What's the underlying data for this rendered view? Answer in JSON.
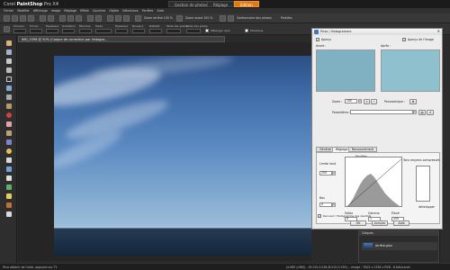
{
  "app": {
    "title_prefix": "Corel ",
    "title_brand": "PaintShop",
    "title_suffix": " Pro X4",
    "workspace_tabs": [
      {
        "label": "Gestion de photos",
        "active": false
      },
      {
        "label": "Réglage",
        "active": false
      },
      {
        "label": "Edition",
        "active": true
      }
    ]
  },
  "menu": [
    "Fichier",
    "Modifier",
    "Affichage",
    "Image",
    "Réglage",
    "Effets",
    "Couches",
    "Objets",
    "Sélections",
    "Fenêtre",
    "Aide"
  ],
  "toolbar1": {
    "zoom_label": "Zoom arrière 100 %",
    "zoom_in_label": "Zoom avant 100 %",
    "manager_label": "Gestionnaire des photos",
    "palettes_label": "Palettes"
  },
  "toolbar2": {
    "fields": [
      "Pinceau",
      "Forme",
      "Épaisseur",
      "Gradation",
      "Étendue",
      "Mode",
      "Épaisseur",
      "Niveaux",
      "Netteté",
      "Taille des pixels",
      "Taille des pixels"
    ],
    "checkbox1": "Mélanger avec",
    "checkbox2": "Mosaïque"
  },
  "document": {
    "tab_title": "IMG_5398 @ 50% (Calque de correction par histogra..."
  },
  "dialog": {
    "title": "Prise / Histogramme",
    "apercu": "Aperçu",
    "apercu_image": "Aperçu de l'image",
    "avant": "Avant :",
    "apres": "Après :",
    "zoom_label": "Zoom :",
    "zoom_value": "100",
    "panoramique": "Panoramique :",
    "parametres": "Paramètres :",
    "tabs": [
      "Général",
      "Réglage",
      "Recouvrement"
    ],
    "modifier": "Modifier",
    "luminance": "Luminance",
    "couleurs": "Couleurs",
    "limite_haut": "Limite haut",
    "limite_haut_value": "255",
    "ton_moyen": "Tons moyens compressés",
    "bas": "Bas",
    "bas_value": "0",
    "faible": "Faible",
    "faible_value": "0",
    "gamma": "Gamma",
    "gamma_value": "1",
    "eleve": "Élevé",
    "eleve_value": "255",
    "recouvrir": "Recouvrir l'histogramme des résultats",
    "developper": "développer",
    "ok": "OK",
    "annuler": "Annuler",
    "aide": "Aide"
  },
  "layers": {
    "title": "Calques",
    "layer_name": "Arrière-plan"
  },
  "status": {
    "left": "Pour obtenir de l'aide, appuyez sur F1",
    "right": "(x:965 y:960) - (R:135,G:184,B:215,O:255) -- Image : 3502 x 2336 x RVB - 8 bits/canal"
  }
}
